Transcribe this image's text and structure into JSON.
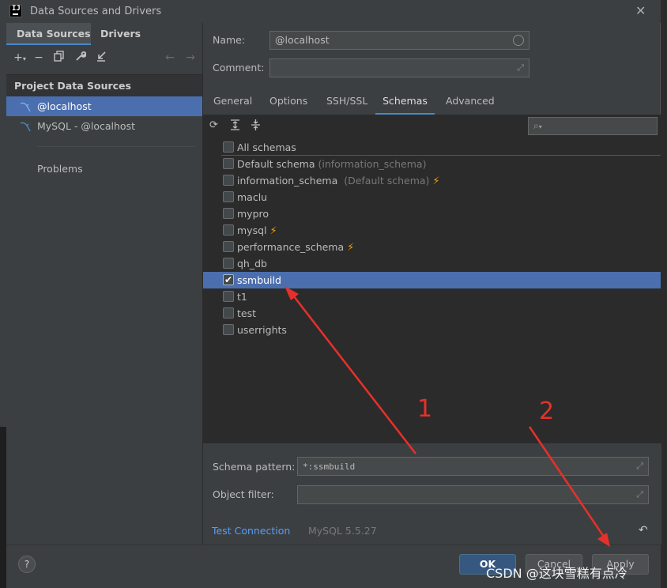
{
  "window": {
    "title": "Data Sources and Drivers"
  },
  "left_tabs": [
    "Data Sources",
    "Drivers"
  ],
  "left_toolbar": {
    "add": "+",
    "remove": "−",
    "copy": "copy-icon",
    "settings": "wrench-icon",
    "import": "import-icon",
    "back": "←",
    "forward": "→"
  },
  "left_section": {
    "title": "Project Data Sources"
  },
  "data_sources": [
    {
      "label": "@localhost",
      "selected": true
    },
    {
      "label": "MySQL - @localhost",
      "selected": false
    }
  ],
  "problems_label": "Problems",
  "form": {
    "name_label": "Name:",
    "name_value": "@localhost",
    "comment_label": "Comment:",
    "comment_value": ""
  },
  "right_tabs": [
    {
      "label": "General",
      "active": false
    },
    {
      "label": "Options",
      "active": false
    },
    {
      "label": "SSH/SSL",
      "active": false
    },
    {
      "label": "Schemas",
      "active": true
    },
    {
      "label": "Advanced",
      "active": false
    }
  ],
  "schema_toolbar": {
    "refresh": "refresh-icon",
    "expand": "expand-all-icon",
    "collapse": "collapse-all-icon",
    "search_placeholder": ""
  },
  "schemas": {
    "all": {
      "label": "All schemas",
      "checked": false
    },
    "items": [
      {
        "label": "Default schema",
        "hint": "(information_schema)",
        "checked": false,
        "bolt": false
      },
      {
        "label": "information_schema",
        "hint": "(Default schema)",
        "checked": false,
        "bolt": true
      },
      {
        "label": "maclu",
        "hint": "",
        "checked": false,
        "bolt": false
      },
      {
        "label": "mypro",
        "hint": "",
        "checked": false,
        "bolt": false
      },
      {
        "label": "mysql",
        "hint": "",
        "checked": false,
        "bolt": true
      },
      {
        "label": "performance_schema",
        "hint": "",
        "checked": false,
        "bolt": true
      },
      {
        "label": "qh_db",
        "hint": "",
        "checked": false,
        "bolt": false
      },
      {
        "label": "ssmbuild",
        "hint": "",
        "checked": true,
        "bolt": false,
        "selected": true
      },
      {
        "label": "t1",
        "hint": "",
        "checked": false,
        "bolt": false
      },
      {
        "label": "test",
        "hint": "",
        "checked": false,
        "bolt": false
      },
      {
        "label": "userrights",
        "hint": "",
        "checked": false,
        "bolt": false
      }
    ]
  },
  "bottom_form": {
    "pattern_label": "Schema pattern:",
    "pattern_value": "*:ssmbuild",
    "filter_label": "Object filter:",
    "filter_value": ""
  },
  "status": {
    "test_connection": "Test Connection",
    "version": "MySQL 5.5.27"
  },
  "footer": {
    "help": "?",
    "ok": "OK",
    "cancel": "Cancel",
    "apply": "Apply"
  },
  "annotations": {
    "step1": "1",
    "step2": "2",
    "color": "#e8302a"
  },
  "watermark": "CSDN @这块雪糕有点冷"
}
